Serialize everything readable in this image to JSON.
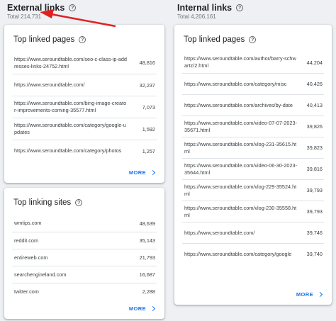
{
  "external": {
    "title": "External links",
    "total": "Total 214,731",
    "top_linked_pages": {
      "title": "Top linked pages",
      "rows": [
        {
          "label": "https://www.seroundtable.com/seo-c-class-ip-addresses-links-24752.html",
          "value": "48,816"
        },
        {
          "label": "https://www.seroundtable.com/",
          "value": "32,237"
        },
        {
          "label": "https://www.seroundtable.com/bing-image-creator-improvements-coming-35577.html",
          "value": "7,073"
        },
        {
          "label": "https://www.seroundtable.com/category/google-updates",
          "value": "1,592"
        },
        {
          "label": "https://www.seroundtable.com/category/photos",
          "value": "1,257"
        }
      ],
      "more": "MORE"
    },
    "top_linking_sites": {
      "title": "Top linking sites",
      "rows": [
        {
          "label": "wmtips.com",
          "value": "48,639"
        },
        {
          "label": "reddit.com",
          "value": "35,143"
        },
        {
          "label": "entireweb.com",
          "value": "21,793"
        },
        {
          "label": "searchengineland.com",
          "value": "16,687"
        },
        {
          "label": "twitter.com",
          "value": "2,288"
        }
      ],
      "more": "MORE"
    }
  },
  "internal": {
    "title": "Internal links",
    "total": "Total 4,206,161",
    "top_linked_pages": {
      "title": "Top linked pages",
      "rows": [
        {
          "label": "https://www.seroundtable.com/author/barry-schwartz/2.html",
          "value": "44,204"
        },
        {
          "label": "https://www.seroundtable.com/category/misc",
          "value": "40,426"
        },
        {
          "label": "https://www.seroundtable.com/archives/by-date",
          "value": "40,413"
        },
        {
          "label": "https://www.seroundtable.com/video-07-07-2023-35671.html",
          "value": "39,826"
        },
        {
          "label": "https://www.seroundtable.com/vlog-231-35615.html",
          "value": "39,823"
        },
        {
          "label": "https://www.seroundtable.com/video-06-30-2023-35644.html",
          "value": "39,816"
        },
        {
          "label": "https://www.seroundtable.com/vlog-229-35524.html",
          "value": "39,793"
        },
        {
          "label": "https://www.seroundtable.com/vlog-230-35558.html",
          "value": "39,793"
        },
        {
          "label": "https://www.seroundtable.com/",
          "value": "39,746"
        },
        {
          "label": "https://www.seroundtable.com/category/google",
          "value": "39,740"
        }
      ],
      "more": "MORE"
    }
  },
  "help_icon": "help-circle-icon",
  "accent": "#1a73e8",
  "annotation_color": "#e02020"
}
